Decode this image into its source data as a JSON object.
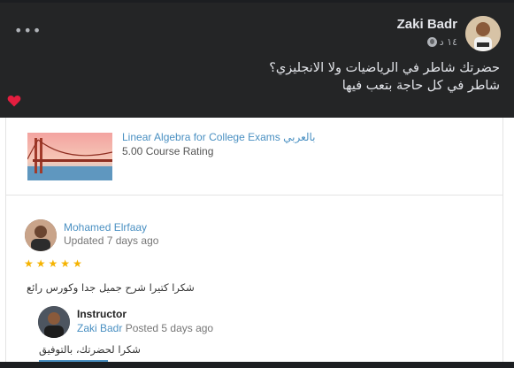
{
  "post": {
    "author": "Zaki Badr",
    "time": "١٤ د",
    "text_line1": "حضرتك شاطر في الرياضيات ولا الانجليزي؟",
    "text_line2": "شاطر في كل حاجة بتعب فيها",
    "more_label": "•••",
    "heart_color": "#e41e3f"
  },
  "course": {
    "title": "Linear Algebra for College Exams بالعربي",
    "rating": "5.00 Course Rating"
  },
  "review": {
    "name": "Mohamed Elrfaay",
    "date": "Updated 7 days ago",
    "stars": 5,
    "text": "شكرا كتيرا شرح جميل جدا وكورس رائع"
  },
  "reply": {
    "label": "Instructor",
    "name": "Zaki Badr",
    "posted": "Posted 5 days ago",
    "text": "شكرا لحضرتك، بالتوفيق"
  },
  "colors": {
    "dark_bg": "#242526",
    "link_blue": "#4a90c2",
    "star": "#f5b301"
  }
}
